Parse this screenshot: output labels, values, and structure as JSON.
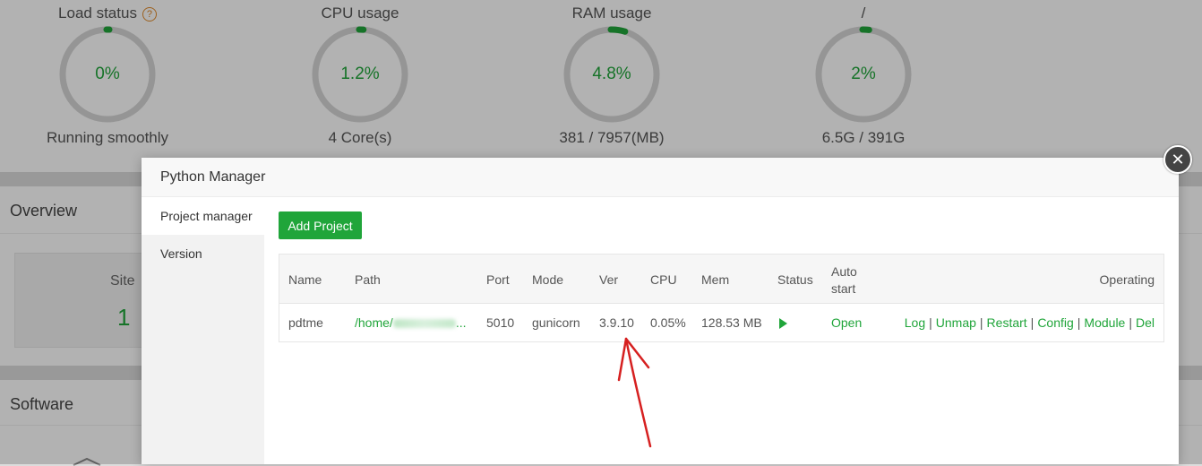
{
  "gauges": [
    {
      "title": "Load status",
      "value": "0%",
      "sub": "Running smoothly",
      "fraction": 0.0
    },
    {
      "title": "CPU usage",
      "value": "1.2%",
      "sub": "4 Core(s)",
      "fraction": 0.012
    },
    {
      "title": "RAM usage",
      "value": "4.8%",
      "sub": "381 / 7957(MB)",
      "fraction": 0.048
    },
    {
      "title": "/",
      "value": "2%",
      "sub": "6.5G / 391G",
      "fraction": 0.02
    }
  ],
  "panels": {
    "overview_title": "Overview",
    "site_label": "Site",
    "site_count": "1",
    "software_title": "Software"
  },
  "modal": {
    "title": "Python Manager",
    "close_glyph": "✕",
    "sidebar": [
      {
        "label": "Project manager",
        "active": true
      },
      {
        "label": "Version",
        "active": false
      }
    ],
    "add_button": "Add Project",
    "table": {
      "headers": {
        "name": "Name",
        "path": "Path",
        "port": "Port",
        "mode": "Mode",
        "ver": "Ver",
        "cpu": "CPU",
        "mem": "Mem",
        "status": "Status",
        "auto_start_1": "Auto",
        "auto_start_2": "start",
        "operating": "Operating"
      },
      "rows": [
        {
          "name": "pdtme",
          "path": "/home/",
          "path_tail": "...",
          "port": "5010",
          "mode": "gunicorn",
          "ver": "3.9.10",
          "cpu": "0.05%",
          "mem": "128.53 MB",
          "status_icon": "play-icon",
          "auto_start": "Open"
        }
      ],
      "ops": [
        "Log",
        "Unmap",
        "Restart",
        "Config",
        "Module",
        "Del"
      ]
    }
  },
  "colors": {
    "accent": "#20a53a",
    "annotation": "#d62020",
    "help": "#e08a2a"
  }
}
